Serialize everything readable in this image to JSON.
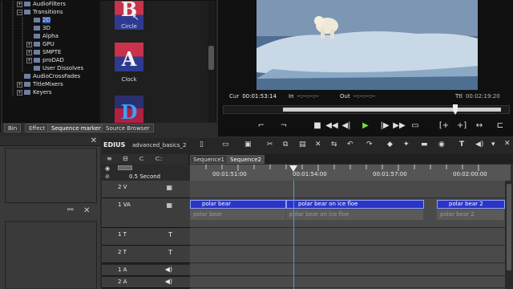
{
  "effects": {
    "tree": [
      {
        "label": "AudioFilters",
        "toggle": "+",
        "folder": true,
        "indent": 1,
        "selected": false
      },
      {
        "label": "Transitions",
        "toggle": "−",
        "folder": true,
        "indent": 1,
        "selected": false
      },
      {
        "label": "2D",
        "toggle": "",
        "folder": true,
        "indent": 2,
        "selected": true
      },
      {
        "label": "3D",
        "toggle": "",
        "folder": true,
        "indent": 2,
        "selected": false
      },
      {
        "label": "Alpha",
        "toggle": "",
        "folder": true,
        "indent": 2,
        "selected": false
      },
      {
        "label": "GPU",
        "toggle": "+",
        "folder": true,
        "indent": 2,
        "selected": false
      },
      {
        "label": "SMPTE",
        "toggle": "+",
        "folder": true,
        "indent": 2,
        "selected": false
      },
      {
        "label": "proDAD",
        "toggle": "+",
        "folder": true,
        "indent": 2,
        "selected": false
      },
      {
        "label": "User Dissolves",
        "toggle": "",
        "folder": true,
        "indent": 2,
        "selected": false
      },
      {
        "label": "AudioCrossFades",
        "toggle": "",
        "folder": true,
        "indent": 1,
        "selected": false
      },
      {
        "label": "TitleMixers",
        "toggle": "+",
        "folder": true,
        "indent": 1,
        "selected": false
      },
      {
        "label": "Keyers",
        "toggle": "+",
        "folder": true,
        "indent": 1,
        "selected": false
      }
    ],
    "thumbnails": [
      {
        "label": "Circle",
        "letter": "B"
      },
      {
        "label": "Clock",
        "letter": "A"
      },
      {
        "label": "",
        "letter": "D"
      }
    ],
    "tabs": [
      "Bin",
      "Effect",
      "Sequence marker",
      "Source Browser"
    ],
    "active_tab": "Sequence marker"
  },
  "player": {
    "cur_label": "Cur",
    "cur_value": "00:01:53:14",
    "in_label": "In",
    "in_value": "--:--:--:--",
    "out_label": "Out",
    "out_value": "--:--:--:--",
    "ttl_label": "Ttl",
    "ttl_value": "00:02:19:20"
  },
  "timeline": {
    "app": "EDIUS",
    "project": "advanced_basics_2",
    "zoom": "0.5 Second",
    "sequence_tabs": [
      "Sequence1",
      "Sequence2"
    ],
    "active_sequence": "Sequence2",
    "ruler_labels": [
      "00:01:51:00",
      "00:01:54:00",
      "00:01:57:00",
      "00:02:00:00"
    ],
    "tracks": [
      {
        "name": "2 V",
        "icon": "▦"
      },
      {
        "name": "1 VA",
        "icon": "▦"
      },
      {
        "name": "1 T",
        "icon": "T"
      },
      {
        "name": "2 T",
        "icon": "T"
      },
      {
        "name": "1 A",
        "icon": "◀)"
      },
      {
        "name": "2 A",
        "icon": "◀)"
      }
    ],
    "clips": [
      {
        "label": "polar bear"
      },
      {
        "label": "polar bear on ice floe"
      },
      {
        "label": "polar bear 2"
      }
    ],
    "audio_clips": [
      {
        "label": "polar bear"
      },
      {
        "label": "polar bear on ice floe"
      },
      {
        "label": "polar bear 2"
      }
    ]
  }
}
